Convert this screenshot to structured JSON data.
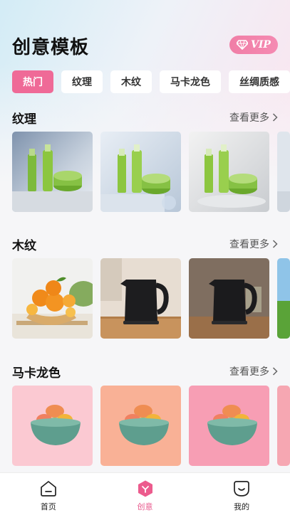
{
  "header": {
    "title": "创意模板",
    "vip_label": "VIP"
  },
  "tabs": [
    {
      "label": "热门",
      "active": true
    },
    {
      "label": "纹理",
      "active": false
    },
    {
      "label": "木纹",
      "active": false
    },
    {
      "label": "马卡龙色",
      "active": false
    },
    {
      "label": "丝绸质感",
      "active": false
    }
  ],
  "sections": [
    {
      "title": "纹理",
      "more_label": "查看更多",
      "thumbs": [
        "green-skincare-set",
        "green-skincare-set-podium",
        "green-skincare-set-light",
        "green-skincare-set-partial"
      ]
    },
    {
      "title": "木纹",
      "more_label": "查看更多",
      "thumbs": [
        "oranges-in-basket",
        "black-kettle-kitchen",
        "black-kettle-brown",
        "meadow-partial"
      ]
    },
    {
      "title": "马卡龙色",
      "more_label": "查看更多",
      "thumbs": [
        "macarons-pink",
        "macarons-peach",
        "macarons-rose",
        "macarons-partial"
      ]
    }
  ],
  "tabbar": [
    {
      "label": "首页",
      "icon": "home-icon",
      "active": false
    },
    {
      "label": "创意",
      "icon": "creative-icon",
      "active": true
    },
    {
      "label": "我的",
      "icon": "smiley-profile-icon",
      "active": false
    }
  ],
  "colors": {
    "accent": "#ef6a97",
    "vip": "#f07ea6",
    "background": "#f6f6f8"
  }
}
